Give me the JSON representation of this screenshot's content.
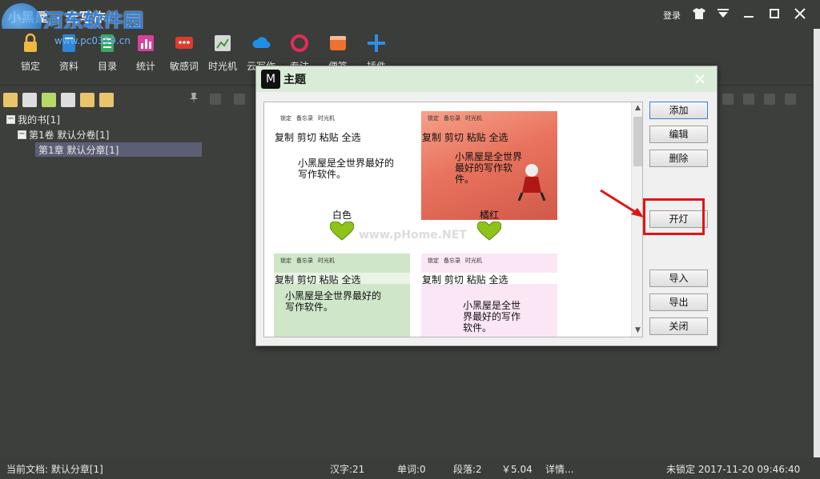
{
  "window": {
    "title": "小黑屋 - 云写作",
    "login_label": "登录",
    "controls": [
      "shirt-icon",
      "dropdown-icon",
      "minimize-icon",
      "maximize-icon",
      "close-icon"
    ]
  },
  "watermark": {
    "name": "河东软件园",
    "url": "www.pc0359.cn"
  },
  "toolbar": {
    "items": [
      {
        "label": "锁定",
        "icon": "lock-icon",
        "color": "#f0b840"
      },
      {
        "label": "资料",
        "icon": "book-icon",
        "color": "#2e86d8"
      },
      {
        "label": "目录",
        "icon": "list-icon",
        "color": "#3aa860"
      },
      {
        "label": "统计",
        "icon": "chart-icon",
        "color": "#d8409a"
      },
      {
        "label": "敏感词",
        "icon": "chat-icon",
        "color": "#e03a2a"
      },
      {
        "label": "时光机",
        "icon": "time-icon",
        "color": "#d8d8d8"
      },
      {
        "label": "云写作",
        "icon": "cloud-icon",
        "color": "#1e8ee8"
      },
      {
        "label": "专注",
        "icon": "ring-icon",
        "color": "#e82a5a"
      },
      {
        "label": "便签",
        "icon": "note-icon",
        "color": "#f07030"
      },
      {
        "label": "插件",
        "icon": "plus-icon",
        "color": "#2e8ee8"
      }
    ]
  },
  "tree": {
    "root": "我的书[1]",
    "volume": "第1卷 默认分卷[1]",
    "chapter": "第1章 默认分章[1]"
  },
  "dialog": {
    "title": "主题",
    "buttons": {
      "add": "添加",
      "edit": "编辑",
      "delete": "删除",
      "light": "开灯",
      "import": "导入",
      "export": "导出",
      "close": "关闭"
    },
    "themes": [
      {
        "name": "白色",
        "ops": "复制 剪切 粘贴 全选",
        "body": "小黑屋是全世界最好的写作软件。",
        "bg": "#ffffff"
      },
      {
        "name": "橘红",
        "ops": "复制 剪切 粘贴 全选",
        "body": "小黑屋是全世界最好的写作软件。",
        "bg": "#e8836a"
      },
      {
        "name": "",
        "ops": "复制 剪切 粘贴 全选",
        "body": "小黑屋是全世界最好的写作软件。",
        "bg": "#cfe6c9"
      },
      {
        "name": "",
        "ops": "复制 剪切 粘贴 全选",
        "body": "小黑屋是全世界最好的写作软件。",
        "bg": "#fbe6f6"
      }
    ],
    "mini_tools": [
      "锁定",
      "备忘录",
      "时光机"
    ],
    "watermark_text": "www.pHome.NET"
  },
  "status": {
    "current_doc": "当前文档: 默认分章[1]",
    "chars": "汉字:21",
    "words": "单词:0",
    "paragraphs": "段落:2",
    "price": "￥5.04",
    "detail": "详情...",
    "lock_time": "未锁定 2017-11-20 09:46:40"
  },
  "colors": {
    "background": "#3c3f3c",
    "dialog_header": "#d9ecd7",
    "highlight_box": "#e01515",
    "selected_node": "#5b5f74"
  }
}
